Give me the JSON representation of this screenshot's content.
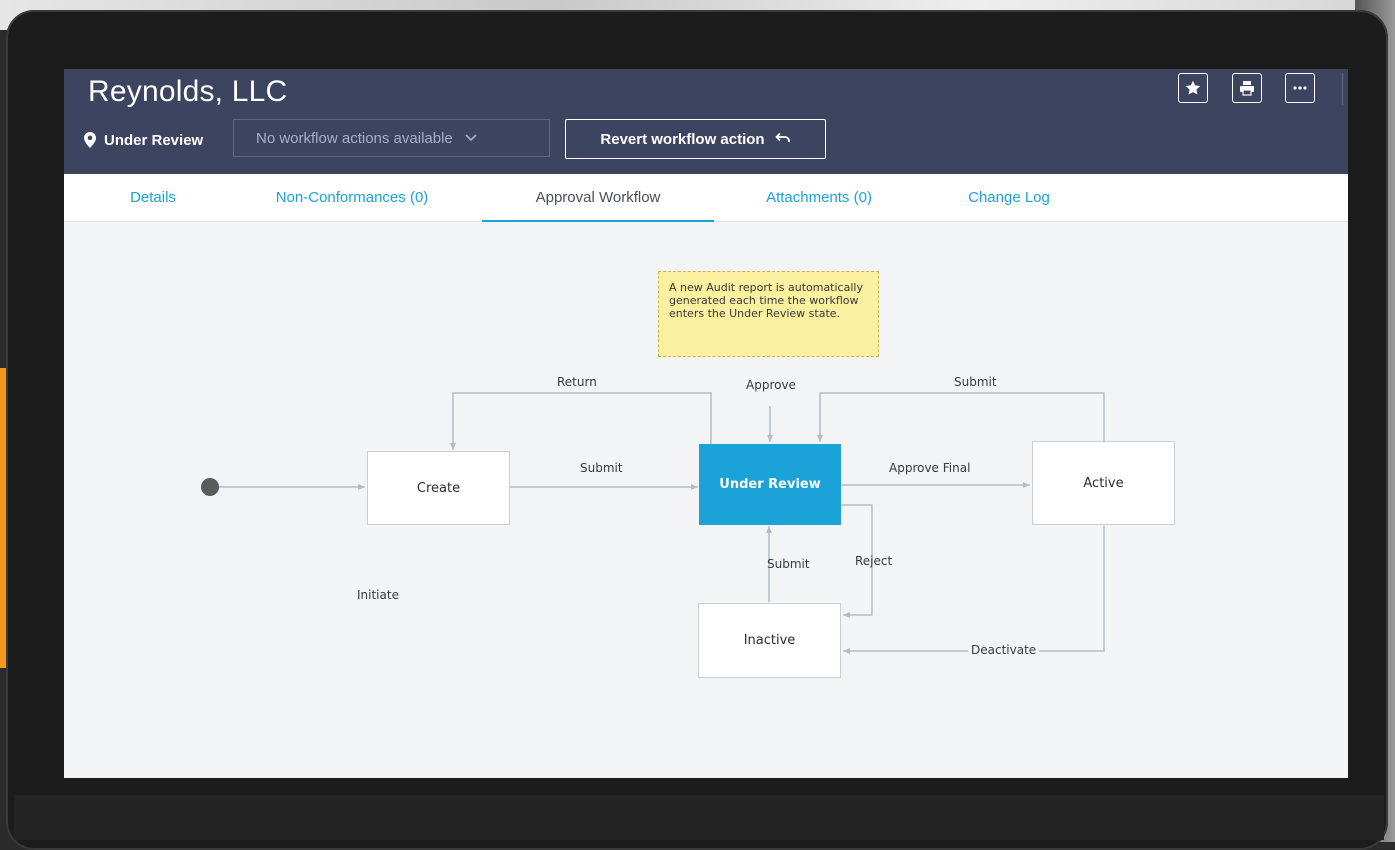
{
  "page": {
    "title": "Reynolds, LLC",
    "status": "Under Review",
    "workflow_dropdown": "No workflow actions available",
    "revert_button": "Revert workflow action"
  },
  "header_actions": [
    {
      "icon": "star-icon"
    },
    {
      "icon": "print-icon"
    },
    {
      "icon": "more-icon"
    }
  ],
  "tabs": [
    {
      "label": "Details"
    },
    {
      "label": "Non-Conformances (0)"
    },
    {
      "label": "Approval Workflow",
      "active": true
    },
    {
      "label": "Attachments (0)"
    },
    {
      "label": "Change Log"
    }
  ],
  "workflow": {
    "note": "A new Audit report is automatically generated each time the workflow enters the Under Review state.",
    "states": {
      "create": "Create",
      "under_review": "Under Review",
      "active": "Active",
      "inactive": "Inactive"
    },
    "transitions": {
      "initiate": "Initiate",
      "submit_create": "Submit",
      "return": "Return",
      "approve": "Approve",
      "submit_active": "Submit",
      "approve_final": "Approve Final",
      "reject": "Reject",
      "submit_inactive": "Submit",
      "deactivate": "Deactivate"
    },
    "current_state": "Under Review"
  },
  "colors": {
    "header_bg": "#3c4460",
    "accent": "#1ba3d8",
    "note_bg": "#fbf0a0",
    "edge": "#aeb6c2"
  }
}
